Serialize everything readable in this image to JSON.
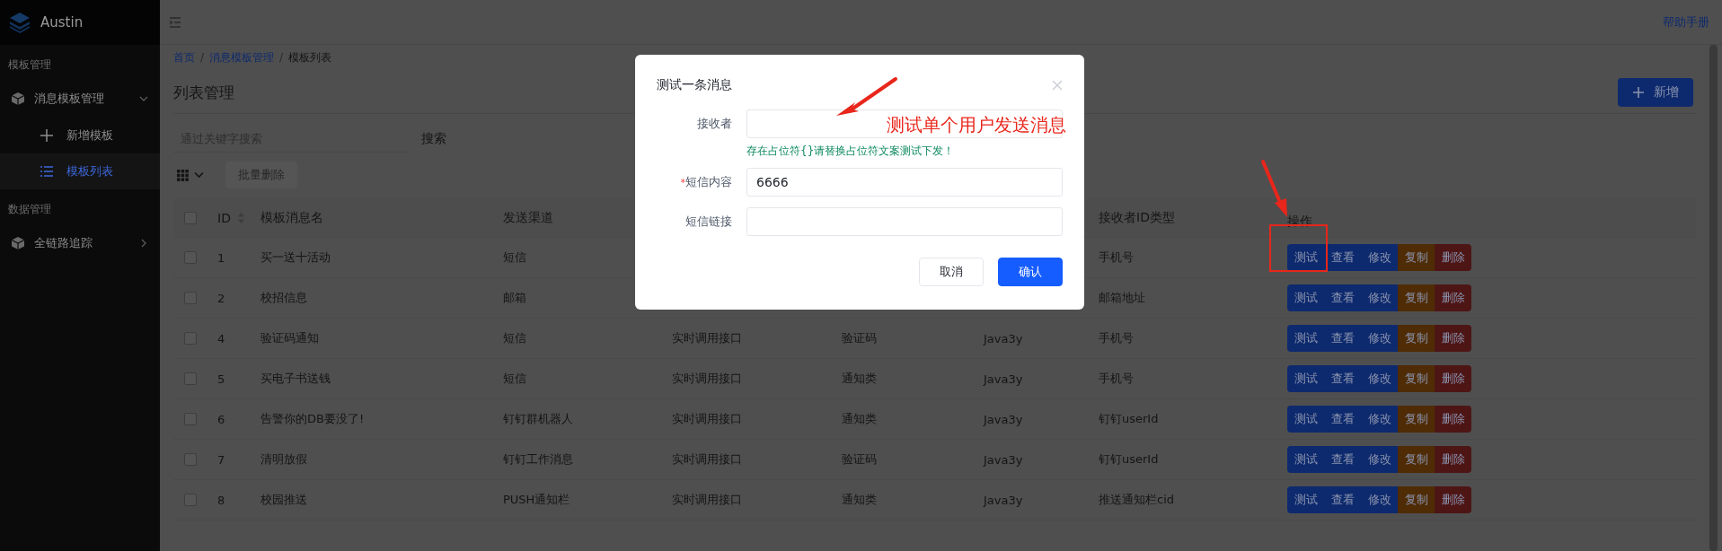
{
  "app": {
    "name": "Austin"
  },
  "sidebar": {
    "groups": [
      {
        "title": "模板管理",
        "items": [
          {
            "label": "消息模板管理",
            "expanded": true,
            "children": [
              {
                "label": "新增模板",
                "selected": false
              },
              {
                "label": "模板列表",
                "selected": true
              }
            ]
          }
        ]
      },
      {
        "title": "数据管理",
        "items": [
          {
            "label": "全链路追踪",
            "expanded": false
          }
        ]
      }
    ]
  },
  "header": {
    "help_link": "帮助手册"
  },
  "breadcrumb": [
    {
      "label": "首页"
    },
    {
      "separator": "/",
      "label": "消息模板管理"
    },
    {
      "separator": "/",
      "label": "模板列表"
    }
  ],
  "page_title": "列表管理",
  "add_button": "新增",
  "search": {
    "placeholder": "通过关键字搜索",
    "button": "搜索"
  },
  "toolbar": {
    "batch_delete": {
      "label": "批量删除",
      "disabled": true
    }
  },
  "table": {
    "header": {
      "checked": false,
      "id": "ID",
      "name": "模板消息名",
      "channel": "发送渠道",
      "receiver_id_type": "接收者ID类型",
      "actions": "操作"
    },
    "rows": [
      {
        "checked": false,
        "id": "1",
        "name": "买一送十活动",
        "channel": "短信",
        "receiver_id_type": "手机号",
        "actions": [
          {
            "label": "测试",
            "color": "#0e2a6e"
          },
          {
            "label": "查看",
            "color": "#0e2a6e"
          },
          {
            "label": "修改",
            "color": "#0e2a6e"
          },
          {
            "label": "复制",
            "color": "#4f2c06"
          },
          {
            "label": "删除",
            "color": "#4e1515"
          }
        ]
      },
      {
        "checked": false,
        "id": "2",
        "name": "校招信息",
        "channel": "邮箱",
        "receiver_id_type": "邮箱地址",
        "actions": [
          {
            "label": "测试",
            "color": "#0e2a6e"
          },
          {
            "label": "查看",
            "color": "#0e2a6e"
          },
          {
            "label": "修改",
            "color": "#0e2a6e"
          },
          {
            "label": "复制",
            "color": "#4f2c06"
          },
          {
            "label": "删除",
            "color": "#4e1515"
          }
        ]
      },
      {
        "checked": false,
        "id": "4",
        "name": "验证码通知",
        "channel": "短信",
        "column_4": "实时调用接口",
        "column_5": "验证码",
        "column_6": "Java3y",
        "receiver_id_type": "手机号",
        "actions": [
          {
            "label": "测试",
            "color": "#0e2a6e"
          },
          {
            "label": "查看",
            "color": "#0e2a6e"
          },
          {
            "label": "修改",
            "color": "#0e2a6e"
          },
          {
            "label": "复制",
            "color": "#4f2c06"
          },
          {
            "label": "删除",
            "color": "#4e1515"
          }
        ]
      },
      {
        "checked": false,
        "id": "5",
        "name": "买电子书送钱",
        "channel": "短信",
        "column_4": "实时调用接口",
        "column_5": "通知类",
        "column_6": "Java3y",
        "receiver_id_type": "手机号",
        "actions": [
          {
            "label": "测试",
            "color": "#0e2a6e"
          },
          {
            "label": "查看",
            "color": "#0e2a6e"
          },
          {
            "label": "修改",
            "color": "#0e2a6e"
          },
          {
            "label": "复制",
            "color": "#4f2c06"
          },
          {
            "label": "删除",
            "color": "#4e1515"
          }
        ]
      },
      {
        "checked": false,
        "id": "6",
        "name": "告警你的DB要没了!",
        "channel": "钉钉群机器人",
        "column_4": "实时调用接口",
        "column_5": "通知类",
        "column_6": "Java3y",
        "receiver_id_type": "钉钉userId",
        "actions": [
          {
            "label": "测试",
            "color": "#0e2a6e"
          },
          {
            "label": "查看",
            "color": "#0e2a6e"
          },
          {
            "label": "修改",
            "color": "#0e2a6e"
          },
          {
            "label": "复制",
            "color": "#4f2c06"
          },
          {
            "label": "删除",
            "color": "#4e1515"
          }
        ]
      },
      {
        "checked": false,
        "id": "7",
        "name": "清明放假",
        "channel": "钉钉工作消息",
        "column_4": "实时调用接口",
        "column_5": "验证码",
        "column_6": "Java3y",
        "receiver_id_type": "钉钉userId",
        "actions": [
          {
            "label": "测试",
            "color": "#0e2a6e"
          },
          {
            "label": "查看",
            "color": "#0e2a6e"
          },
          {
            "label": "修改",
            "color": "#0e2a6e"
          },
          {
            "label": "复制",
            "color": "#4f2c06"
          },
          {
            "label": "删除",
            "color": "#4e1515"
          }
        ]
      },
      {
        "checked": false,
        "id": "8",
        "name": "校园推送",
        "channel": "PUSH通知栏",
        "column_4": "实时调用接口",
        "column_5": "通知类",
        "column_6": "Java3y",
        "receiver_id_type": "推送通知栏cid",
        "actions": [
          {
            "label": "测试",
            "color": "#0e2a6e"
          },
          {
            "label": "查看",
            "color": "#0e2a6e"
          },
          {
            "label": "修改",
            "color": "#0e2a6e"
          },
          {
            "label": "复制",
            "color": "#4f2c06"
          },
          {
            "label": "删除",
            "color": "#4e1515"
          }
        ]
      }
    ]
  },
  "dialog": {
    "title": "测试一条消息",
    "fields": [
      {
        "label": "接收者",
        "hint": "存在占位符{}请替换占位符文案测试下发！"
      },
      {
        "label": "短信内容",
        "required_marker": "*",
        "value": "6666"
      },
      {
        "label": "短信链接"
      }
    ],
    "cancel": "取消",
    "confirm": "确认"
  },
  "annotation": {
    "note": "测试单个用户发送消息"
  }
}
